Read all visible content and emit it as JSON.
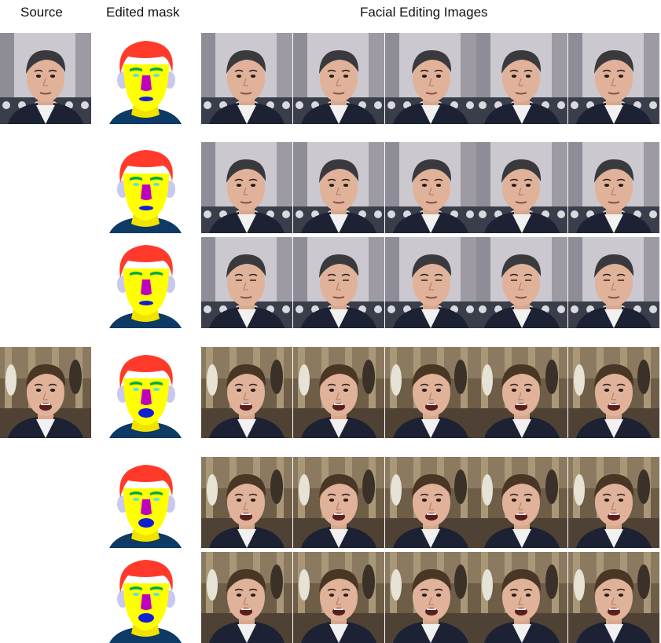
{
  "headers": {
    "source": "Source",
    "mask": "Edited mask",
    "facial_editing": "Facial Editing Images"
  },
  "palette": {
    "hair": "#ff3a2a",
    "skin": "#ffff00",
    "brow": "#00a94f",
    "eye": "#58e0e8",
    "nose": "#c000c0",
    "mouth": "#0f1fd6",
    "ear": "#c8c8f0",
    "neck": "#f2e200",
    "cloth": "#0e3a66",
    "bg_studio": "#c9c6cc",
    "bg_capitol": "#6b5a44"
  },
  "subjects": [
    {
      "id": "subject-1",
      "background": "studio",
      "rows": [
        {
          "has_source": true,
          "mask": {
            "mouth_open": false,
            "eyes_closed": false
          }
        },
        {
          "has_source": false,
          "mask": {
            "mouth_open": false,
            "eyes_closed": false
          }
        },
        {
          "has_source": false,
          "mask": {
            "mouth_open": false,
            "eyes_closed": true
          }
        }
      ]
    },
    {
      "id": "subject-2",
      "background": "capitol",
      "rows": [
        {
          "has_source": true,
          "mask": {
            "mouth_open": true,
            "eyes_closed": false
          }
        },
        {
          "has_source": false,
          "mask": {
            "mouth_open": true,
            "eyes_closed": false
          }
        },
        {
          "has_source": false,
          "mask": {
            "mouth_open": true,
            "eyes_closed": false
          }
        }
      ]
    }
  ],
  "frames_per_row": 5
}
